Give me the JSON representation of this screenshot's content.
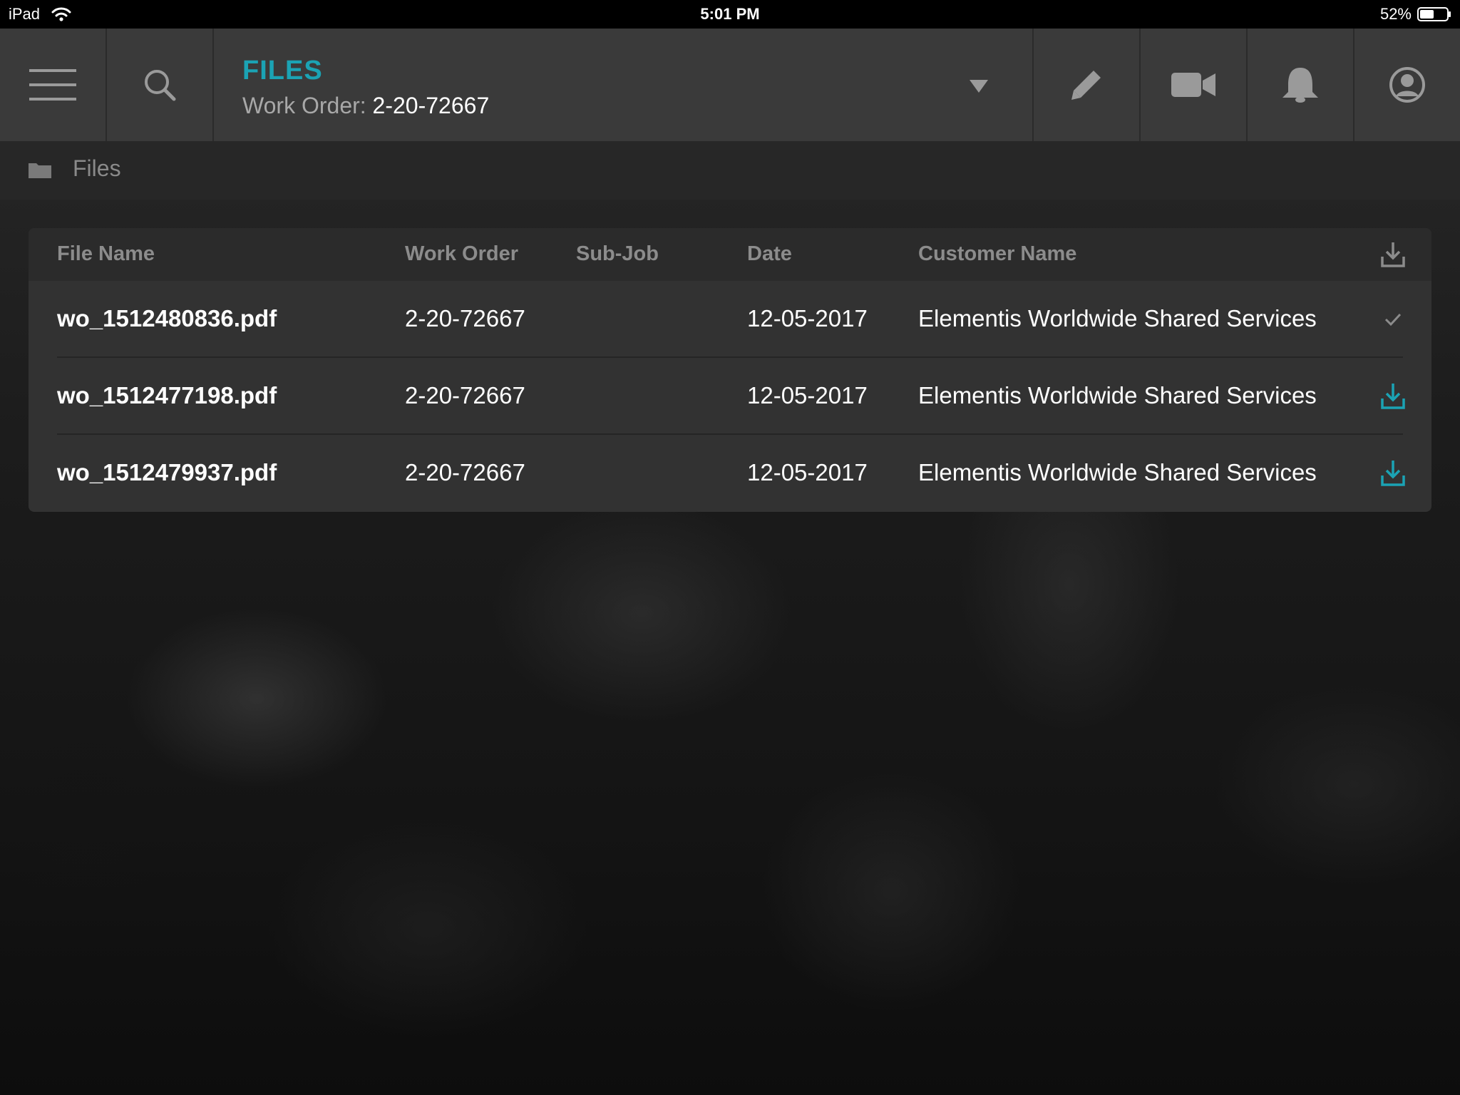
{
  "status_bar": {
    "device": "iPad",
    "time": "5:01 PM",
    "battery": "52%",
    "battery_level": 0.52
  },
  "header": {
    "title": "FILES",
    "work_order_label": "Work Order:",
    "work_order_value": "2-20-72667",
    "icons": [
      "menu-icon",
      "search-icon",
      "dropdown-icon",
      "pencil-icon",
      "video-icon",
      "bell-icon",
      "user-icon"
    ]
  },
  "breadcrumb": {
    "icon": "folder-icon",
    "label": "Files"
  },
  "table": {
    "columns": [
      "File Name",
      "Work Order",
      "Sub-Job",
      "Date",
      "Customer Name"
    ],
    "header_action_icon": "download-icon",
    "rows": [
      {
        "file_name": "wo_1512480836.pdf",
        "work_order": "2-20-72667",
        "sub_job": "",
        "date": "12-05-2017",
        "customer": "Elementis Worldwide Shared Services",
        "action_icon": "checkmark-icon"
      },
      {
        "file_name": "wo_1512477198.pdf",
        "work_order": "2-20-72667",
        "sub_job": "",
        "date": "12-05-2017",
        "customer": "Elementis Worldwide Shared Services",
        "action_icon": "download-icon"
      },
      {
        "file_name": "wo_1512479937.pdf",
        "work_order": "2-20-72667",
        "sub_job": "",
        "date": "12-05-2017",
        "customer": "Elementis Worldwide Shared Services",
        "action_icon": "download-icon"
      }
    ]
  },
  "colors": {
    "accent": "#1ba3b4",
    "header_bg": "#3a3a3a",
    "muted_text": "#8c8c8c"
  }
}
